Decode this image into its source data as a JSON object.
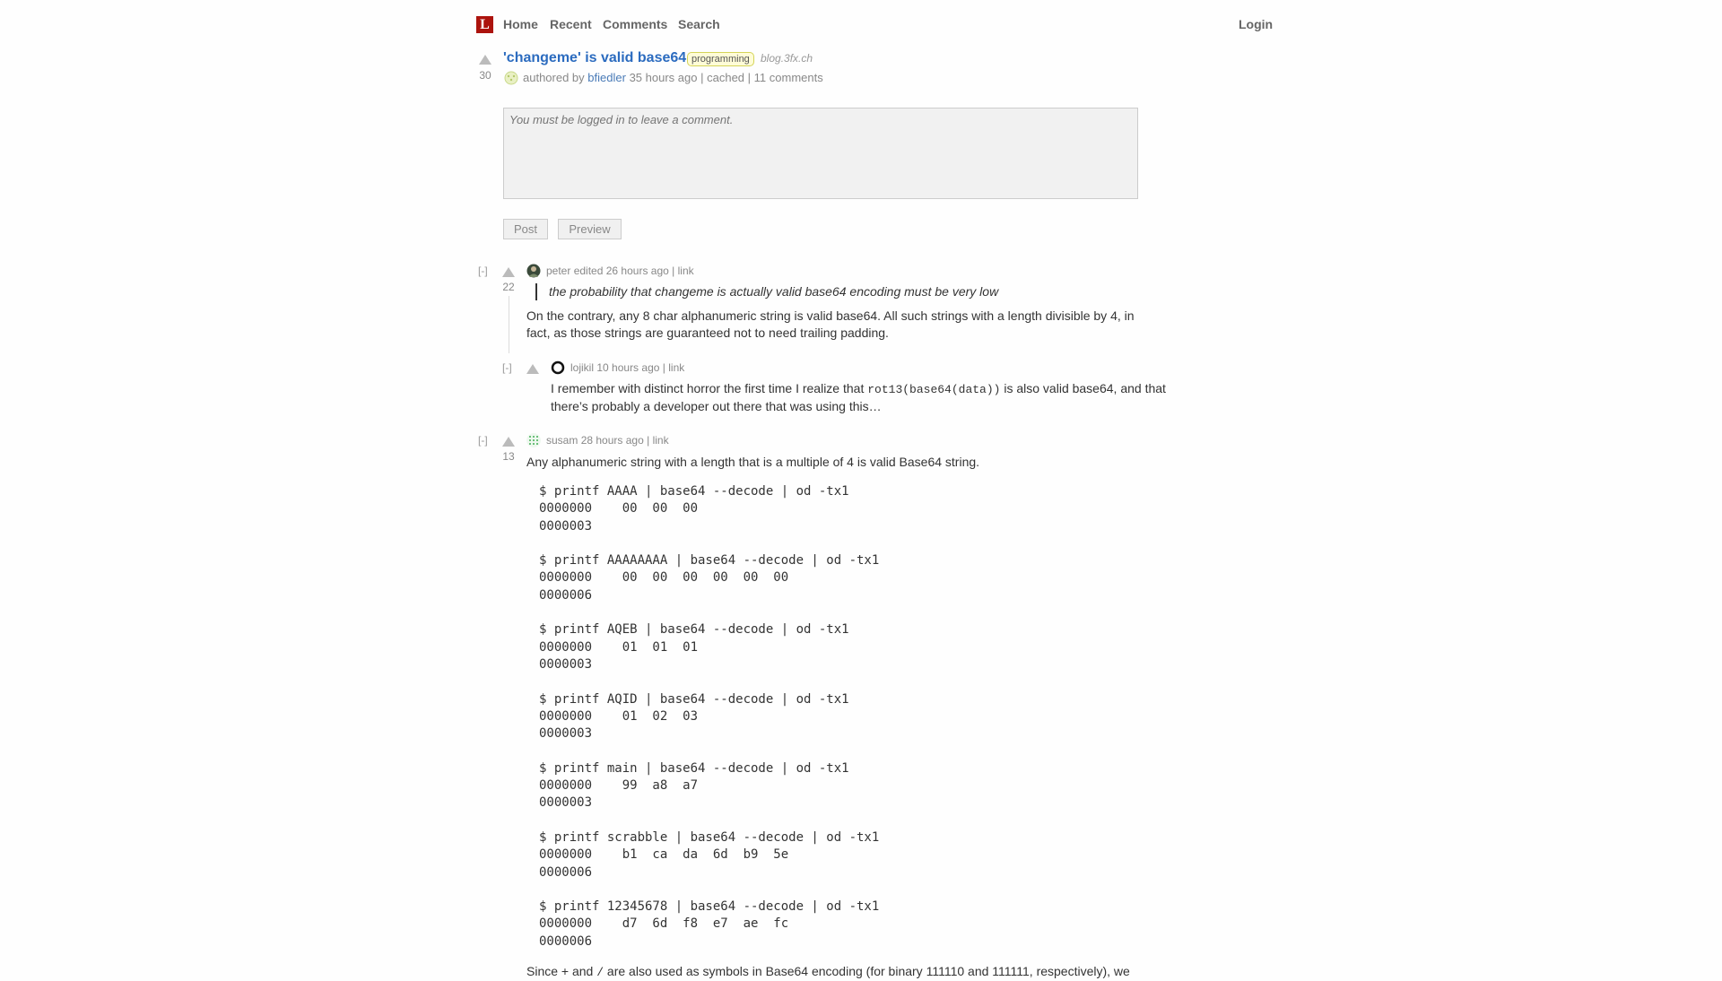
{
  "header": {
    "logo": "L",
    "nav": [
      "Home",
      "Recent",
      "Comments",
      "Search"
    ],
    "login": "Login"
  },
  "story": {
    "score": "30",
    "title": "'changeme' is valid base64",
    "tag": "programming",
    "domain": "blog.3fx.ch",
    "authored_by": "authored by",
    "author": "bfiedler",
    "age": "35 hours ago",
    "cached": "cached",
    "comments": "11 comments",
    "separator": "|"
  },
  "comment_form": {
    "placeholder": "You must be logged in to leave a comment.",
    "post_label": "Post",
    "preview_label": "Preview"
  },
  "comments": [
    {
      "collapse": "[-]",
      "score": "22",
      "user": "peter",
      "edited": "edited",
      "age": "26 hours ago",
      "link": "link",
      "quote": "the probability that changeme is actually valid base64 encoding must be very low",
      "body_line1": "On the contrary, any 8 char alphanumeric string is valid base64. All such strings with a length divisible by 4, in",
      "body_line2": "fact, as those strings are guaranteed not to need trailing padding."
    },
    {
      "collapse": "[-]",
      "user": "lojikil",
      "age": "10 hours ago",
      "link": "link",
      "body_pre": "I remember with distinct horror the first time I realize that ",
      "body_code": "rot13(base64(data))",
      "body_post": " is also valid base64, and that",
      "body_line2": "there’s probably a developer out there that was using this…"
    },
    {
      "collapse": "[-]",
      "score": "13",
      "user": "susam",
      "age": "28 hours ago",
      "link": "link",
      "body_line1": "Any alphanumeric string with a length that is a multiple of 4 is valid Base64 string.",
      "code": "$ printf AAAA | base64 --decode | od -tx1\n0000000    00  00  00\n0000003\n\n$ printf AAAAAAAA | base64 --decode | od -tx1\n0000000    00  00  00  00  00  00\n0000006\n\n$ printf AQEB | base64 --decode | od -tx1\n0000000    01  01  01\n0000003\n\n$ printf AQID | base64 --decode | od -tx1\n0000000    01  02  03\n0000003\n\n$ printf main | base64 --decode | od -tx1\n0000000    99  a8  a7\n0000003\n\n$ printf scrabble | base64 --decode | od -tx1\n0000000    b1  ca  da  6d  b9  5e\n0000006\n\n$ printf 12345678 | base64 --decode | od -tx1\n0000000    d7  6d  f8  e7  ae  fc\n0000006",
      "footer_pre": "Since + and ",
      "footer_code": "/",
      "footer_post": " are also used as symbols in Base64 encoding (for binary 111110 and 111111, respectively), we"
    }
  ],
  "colors": {
    "logo": "#ac130d",
    "title_link": "#2b6bbf",
    "user_link": "#4a7bb7",
    "tag_bg": "#fffcd7",
    "tag_border": "#d5d458"
  }
}
